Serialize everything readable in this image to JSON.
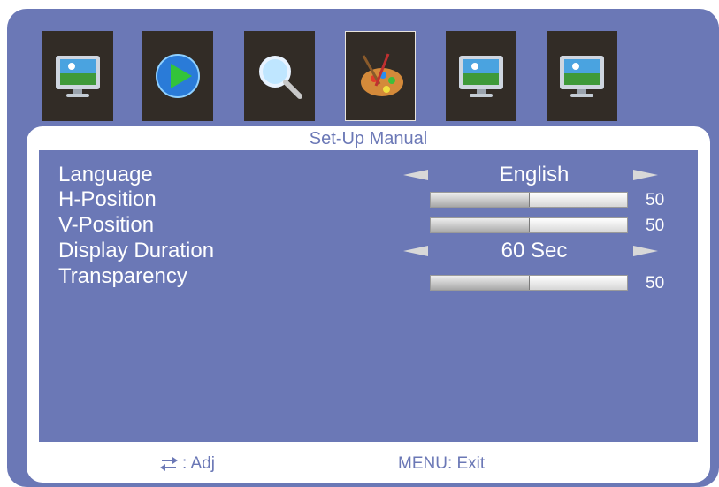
{
  "tabs": [
    {
      "icon": "monitor-picture-icon",
      "active": false
    },
    {
      "icon": "play-arrow-icon",
      "active": false
    },
    {
      "icon": "magnifier-icon",
      "active": false
    },
    {
      "icon": "palette-brush-icon",
      "active": true
    },
    {
      "icon": "monitor-picture-icon",
      "active": false
    },
    {
      "icon": "monitor-picture-icon",
      "active": false
    }
  ],
  "panel": {
    "title": "Set-Up Manual"
  },
  "settings": {
    "language": {
      "label": "Language",
      "value": "English"
    },
    "h_position": {
      "label": "H-Position",
      "value": "50",
      "level": 0.5
    },
    "v_position": {
      "label": "V-Position",
      "value": "50",
      "level": 0.5
    },
    "display_duration": {
      "label": "Display Duration",
      "value": "60 Sec"
    },
    "transparency": {
      "label": "Transparency",
      "value": "50",
      "level": 0.5
    }
  },
  "footer": {
    "adjust_label": ": Adj",
    "exit_label": "MENU: Exit"
  },
  "colors": {
    "background": "#6b78b6",
    "panel": "#ffffff",
    "tab": "#322c26"
  }
}
